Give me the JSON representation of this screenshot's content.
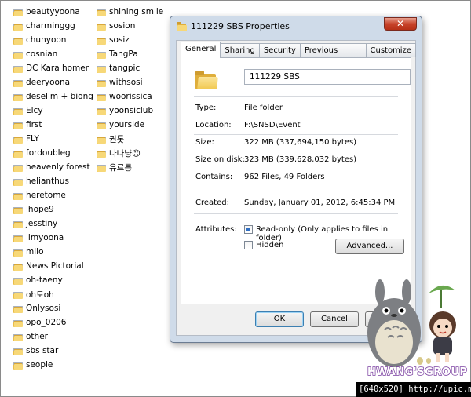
{
  "folders_col1": [
    "beautyyoona",
    "charminggg",
    "chunyoon",
    "cosnian",
    "DC Kara homer",
    "deeryoona",
    "deselim + biong",
    "Elcy",
    "first",
    "FLY",
    "fordoubleg",
    "heavenly forest",
    "helianthus",
    "heretome",
    "ihope9",
    "jesstiny",
    "limyoona",
    "milo",
    "News Pictorial",
    "oh-taeny",
    "oh토oh",
    "Onlysosi",
    "opo_0206",
    "other",
    "sbs star",
    "seople"
  ],
  "folders_col2": [
    "shining smile",
    "sosion",
    "sosiz",
    "TangPa",
    "tangpic",
    "withsosi",
    "woorissica",
    "yoonsiclub",
    "yourside",
    "권톳",
    "나나냥☺",
    "유르릉"
  ],
  "dialog": {
    "title": "111229 SBS Properties",
    "close_label": "✕",
    "tabs": [
      "General",
      "Sharing",
      "Security",
      "Previous Versions",
      "Customize"
    ],
    "name_value": "111229 SBS",
    "type_label": "Type:",
    "type_value": "File folder",
    "location_label": "Location:",
    "location_value": "F:\\SNSD\\Event",
    "size_label": "Size:",
    "size_value": "322 MB (337,694,150 bytes)",
    "size_disk_label": "Size on disk:",
    "size_disk_value": "323 MB (339,628,032 bytes)",
    "contains_label": "Contains:",
    "contains_value": "962 Files, 49 Folders",
    "created_label": "Created:",
    "created_value": "Sunday, January 01, 2012, 6:45:34 PM",
    "attributes_label": "Attributes:",
    "readonly_label": "Read-only (Only applies to files in folder)",
    "hidden_label": "Hidden",
    "advanced_button": "Advanced...",
    "ok_button": "OK",
    "cancel_button": "Cancel"
  },
  "logo_text": "HWANG'SGROUP",
  "watermark": "[640x520] http://upic.me/"
}
